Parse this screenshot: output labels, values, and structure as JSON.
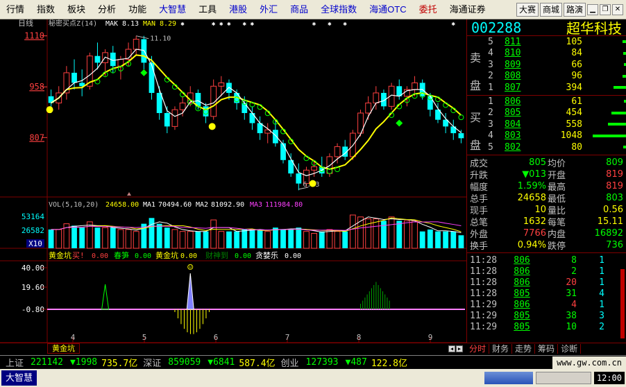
{
  "menu": {
    "items": [
      {
        "label": "行情",
        "color": "normal"
      },
      {
        "label": "指数",
        "color": "normal"
      },
      {
        "label": "板块",
        "color": "normal"
      },
      {
        "label": "分析",
        "color": "normal"
      },
      {
        "label": "功能",
        "color": "normal"
      },
      {
        "label": "大智慧",
        "color": "blue"
      },
      {
        "label": "工具",
        "color": "normal"
      },
      {
        "label": "港股",
        "color": "blue"
      },
      {
        "label": "外汇",
        "color": "blue"
      },
      {
        "label": "商品",
        "color": "blue"
      },
      {
        "label": "全球指数",
        "color": "blue"
      },
      {
        "label": "海通OTC",
        "color": "blue"
      },
      {
        "label": "委托",
        "color": "red"
      },
      {
        "label": "海通证券",
        "color": "normal"
      }
    ],
    "right_buttons": [
      "大赛",
      "商城",
      "路演"
    ],
    "window_buttons": [
      "minimize-icon",
      "restore-icon",
      "close-icon"
    ]
  },
  "main_chart": {
    "period_label": "日线",
    "indicator_label": "秘密买点Z(14)",
    "mak_label": "MAK",
    "mak_value": "8.13",
    "man_label": "MAN",
    "man_value": "8.29",
    "high_label": "11.10",
    "low_label": "6.53",
    "y_ticks": [
      "1110",
      "958",
      "807"
    ]
  },
  "volume": {
    "label": "VOL(5,10,20)",
    "vol_value": "24658.00",
    "ma1_label": "MA1",
    "ma1_value": "70494.60",
    "ma2_label": "MA2",
    "ma2_value": "81092.90",
    "ma3_label": "MA3",
    "ma3_value": "111984.80",
    "y_ticks": [
      "53164",
      "26582"
    ],
    "unit": "X10"
  },
  "indicator": {
    "name": "黄金坑",
    "buy_label": "买!",
    "buy_value": "0.00",
    "chunsun_label": "春笋",
    "chunsun_value": "0.00",
    "hjk_label": "黄金坑",
    "hjk_value": "0.00",
    "cs_label": "财神到",
    "cs_value": "0.00",
    "tan_label": "贪婪乐",
    "tan_value": "0.00",
    "y_ticks": [
      "40.00",
      "19.60",
      "-0.80"
    ]
  },
  "x_ticks": [
    "4",
    "5",
    "6",
    "7",
    "8",
    "9"
  ],
  "stock": {
    "code": "002288",
    "name": "超华科技"
  },
  "orderbook": {
    "sell_label": "卖盘",
    "buy_label": "买盘",
    "asks": [
      {
        "n": "5",
        "price": "811",
        "vol": "105",
        "bar": 0.05
      },
      {
        "n": "4",
        "price": "810",
        "vol": "84",
        "bar": 0.04
      },
      {
        "n": "3",
        "price": "809",
        "vol": "66",
        "bar": 0.03
      },
      {
        "n": "2",
        "price": "808",
        "vol": "96",
        "bar": 0.05
      },
      {
        "n": "1",
        "price": "807",
        "vol": "394",
        "bar": 0.19
      }
    ],
    "bids": [
      {
        "n": "1",
        "price": "806",
        "vol": "61",
        "bar": 0.03
      },
      {
        "n": "2",
        "price": "805",
        "vol": "454",
        "bar": 0.22
      },
      {
        "n": "3",
        "price": "804",
        "vol": "558",
        "bar": 0.27
      },
      {
        "n": "4",
        "price": "803",
        "vol": "1048",
        "bar": 0.5
      },
      {
        "n": "5",
        "price": "802",
        "vol": "80",
        "bar": 0.04
      }
    ]
  },
  "stats": [
    {
      "k1": "成交",
      "v1": "805",
      "c1": "g",
      "k2": "均价",
      "v2": "809",
      "c2": "g"
    },
    {
      "k1": "升跌",
      "v1": "▼013",
      "c1": "g",
      "k2": "开盘",
      "v2": "819",
      "c2": "r"
    },
    {
      "k1": "幅度",
      "v1": "1.59%",
      "c1": "g",
      "k2": "最高",
      "v2": "819",
      "c2": "r"
    },
    {
      "k1": "总手",
      "v1": "24658",
      "c1": "y",
      "k2": "最低",
      "v2": "803",
      "c2": "g"
    },
    {
      "k1": "现手",
      "v1": "10",
      "c1": "y",
      "k2": "量比",
      "v2": "0.56",
      "c2": "y"
    },
    {
      "k1": "总笔",
      "v1": "1632",
      "c1": "y",
      "k2": "每笔",
      "v2": "15.11",
      "c2": "y"
    },
    {
      "k1": "外盘",
      "v1": "7766",
      "c1": "r",
      "k2": "内盘",
      "v2": "16892",
      "c2": "g"
    },
    {
      "k1": "换手",
      "v1": "0.94%",
      "c1": "y",
      "k2": "跌停",
      "v2": "736",
      "c2": "g"
    }
  ],
  "ticks": [
    {
      "time": "11:28",
      "price": "806",
      "vol": "8",
      "vc": "g",
      "cnt": "1"
    },
    {
      "time": "11:28",
      "price": "806",
      "vol": "2",
      "vc": "g",
      "cnt": "1"
    },
    {
      "time": "11:28",
      "price": "806",
      "vol": "20",
      "vc": "r",
      "cnt": "1"
    },
    {
      "time": "11:28",
      "price": "805",
      "vol": "31",
      "vc": "g",
      "cnt": "4"
    },
    {
      "time": "11:29",
      "price": "806",
      "vol": "4",
      "vc": "r",
      "cnt": "1"
    },
    {
      "time": "11:29",
      "price": "805",
      "vol": "38",
      "vc": "g",
      "cnt": "3"
    },
    {
      "time": "11:29",
      "price": "805",
      "vol": "10",
      "vc": "g",
      "cnt": "2"
    }
  ],
  "bottom_tabs": {
    "left_tab": "黄金坑",
    "right_tabs": [
      "分时",
      "财务",
      "走势",
      "筹码",
      "诊断"
    ]
  },
  "ticker": [
    {
      "name": "上证",
      "value": "221142",
      "change": "▼1998",
      "amount": "735.7亿"
    },
    {
      "name": "深证",
      "value": "859059",
      "change": "▼6841",
      "amount": "587.4亿"
    },
    {
      "name": "创业",
      "value": "127393",
      "change": "▼487",
      "amount": "122.8亿"
    }
  ],
  "ticker_url": "www.gw.com.cn",
  "status": {
    "app_name": "大智慧",
    "time": "12:00"
  },
  "colors": {
    "up": "#ff4040",
    "down": "#00ffff",
    "ma_white": "#ffffff",
    "ma_yellow": "#ffff00",
    "grid": "#800000",
    "background": "#000000"
  },
  "chart_data": {
    "type": "candlestick",
    "price_range": [
      6.3,
      11.3
    ],
    "reference_ticks": [
      11.1,
      9.58,
      8.07
    ],
    "high_marker": 11.1,
    "low_marker": 6.53,
    "candles": [
      [
        9.3,
        9.5,
        8.8,
        9.1
      ],
      [
        9.1,
        9.6,
        8.9,
        9.4
      ],
      [
        9.4,
        10.2,
        9.2,
        10.0
      ],
      [
        10.0,
        10.4,
        9.5,
        9.7
      ],
      [
        9.7,
        10.1,
        9.3,
        9.6
      ],
      [
        9.6,
        10.6,
        9.5,
        10.5
      ],
      [
        10.5,
        10.9,
        10.1,
        10.3
      ],
      [
        10.3,
        10.7,
        9.9,
        10.6
      ],
      [
        10.6,
        10.8,
        10.0,
        10.2
      ],
      [
        10.2,
        10.5,
        9.8,
        10.4
      ],
      [
        10.4,
        10.9,
        10.2,
        10.7
      ],
      [
        10.7,
        11.1,
        10.5,
        11.0
      ],
      [
        11.0,
        11.1,
        10.1,
        10.3
      ],
      [
        10.3,
        10.5,
        9.2,
        9.4
      ],
      [
        9.4,
        9.6,
        8.6,
        8.8
      ],
      [
        8.8,
        9.0,
        8.2,
        8.4
      ],
      [
        8.4,
        9.0,
        8.3,
        8.9
      ],
      [
        8.9,
        9.3,
        8.7,
        9.1
      ],
      [
        9.1,
        9.6,
        9.0,
        9.4
      ],
      [
        9.4,
        9.5,
        8.9,
        9.0
      ],
      [
        9.0,
        9.1,
        8.5,
        8.7
      ],
      [
        8.7,
        9.8,
        8.6,
        9.6
      ],
      [
        9.6,
        9.9,
        9.3,
        9.7
      ],
      [
        9.7,
        9.8,
        9.2,
        9.4
      ],
      [
        9.4,
        9.5,
        8.9,
        9.1
      ],
      [
        9.1,
        9.3,
        8.6,
        8.8
      ],
      [
        8.8,
        9.0,
        8.3,
        8.5
      ],
      [
        8.5,
        8.7,
        8.0,
        8.2
      ],
      [
        8.2,
        8.5,
        7.9,
        8.3
      ],
      [
        8.3,
        8.6,
        7.8,
        7.9
      ],
      [
        7.9,
        8.0,
        7.3,
        7.4
      ],
      [
        7.4,
        7.6,
        6.9,
        7.0
      ],
      [
        7.0,
        7.3,
        6.5,
        6.7
      ],
      [
        6.7,
        7.2,
        6.6,
        7.1
      ],
      [
        7.1,
        7.4,
        6.9,
        7.2
      ],
      [
        7.2,
        7.5,
        6.9,
        7.0
      ],
      [
        7.0,
        7.6,
        6.9,
        7.5
      ],
      [
        7.5,
        7.9,
        7.3,
        7.8
      ],
      [
        7.8,
        8.0,
        7.4,
        7.5
      ],
      [
        7.5,
        8.3,
        7.4,
        8.2
      ],
      [
        8.2,
        8.9,
        8.1,
        8.8
      ],
      [
        8.8,
        9.3,
        8.6,
        9.1
      ],
      [
        9.1,
        9.6,
        8.9,
        9.4
      ],
      [
        9.4,
        9.5,
        8.9,
        9.0
      ],
      [
        9.0,
        9.7,
        8.9,
        9.6
      ],
      [
        9.6,
        9.8,
        9.2,
        9.3
      ],
      [
        9.3,
        9.6,
        9.0,
        9.5
      ],
      [
        9.5,
        9.9,
        9.3,
        9.7
      ],
      [
        9.7,
        9.8,
        9.2,
        9.3
      ],
      [
        9.3,
        9.4,
        8.7,
        8.9
      ],
      [
        8.9,
        9.1,
        8.5,
        8.6
      ],
      [
        8.6,
        8.8,
        8.2,
        8.4
      ],
      [
        8.4,
        8.6,
        8.0,
        8.2
      ],
      [
        8.2,
        8.3,
        7.9,
        8.05
      ]
    ]
  }
}
